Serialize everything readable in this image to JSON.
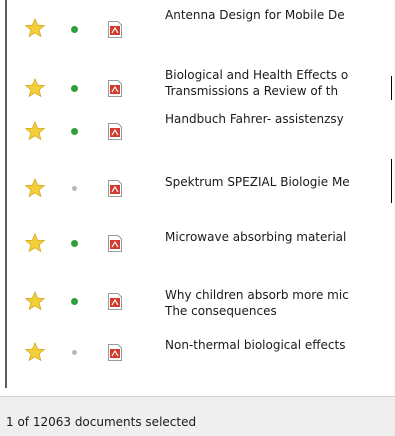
{
  "documents": [
    {
      "title_lines": [
        "Antenna Design for Mobile De"
      ],
      "starred": true,
      "status": "green",
      "icon": "pdf-icon"
    },
    {
      "title_lines": [
        "Biological and Health Effects o",
        "Transmissions a Review of th"
      ],
      "starred": true,
      "status": "green",
      "icon": "pdf-icon"
    },
    {
      "title_lines": [
        "Handbuch Fahrer- assistenzsy"
      ],
      "starred": true,
      "status": "green",
      "icon": "pdf-icon"
    },
    {
      "title_lines": [
        "Spektrum SPEZIAL Biologie Me"
      ],
      "starred": true,
      "status": "grey",
      "icon": "pdf-icon"
    },
    {
      "title_lines": [
        "Microwave absorbing material"
      ],
      "starred": true,
      "status": "green",
      "icon": "pdf-icon"
    },
    {
      "title_lines": [
        "Why children absorb more mic",
        "The consequences"
      ],
      "starred": true,
      "status": "green",
      "icon": "pdf-icon"
    },
    {
      "title_lines": [
        "Non-thermal biological effects"
      ],
      "starred": true,
      "status": "grey",
      "icon": "pdf-icon"
    }
  ],
  "status_bar": {
    "text": "1 of 12063 documents selected"
  },
  "colors": {
    "star": "#f3cf3a",
    "status_green": "#2e9e3a",
    "status_grey": "#b8b8b8",
    "pdf_red": "#d23b2e"
  }
}
